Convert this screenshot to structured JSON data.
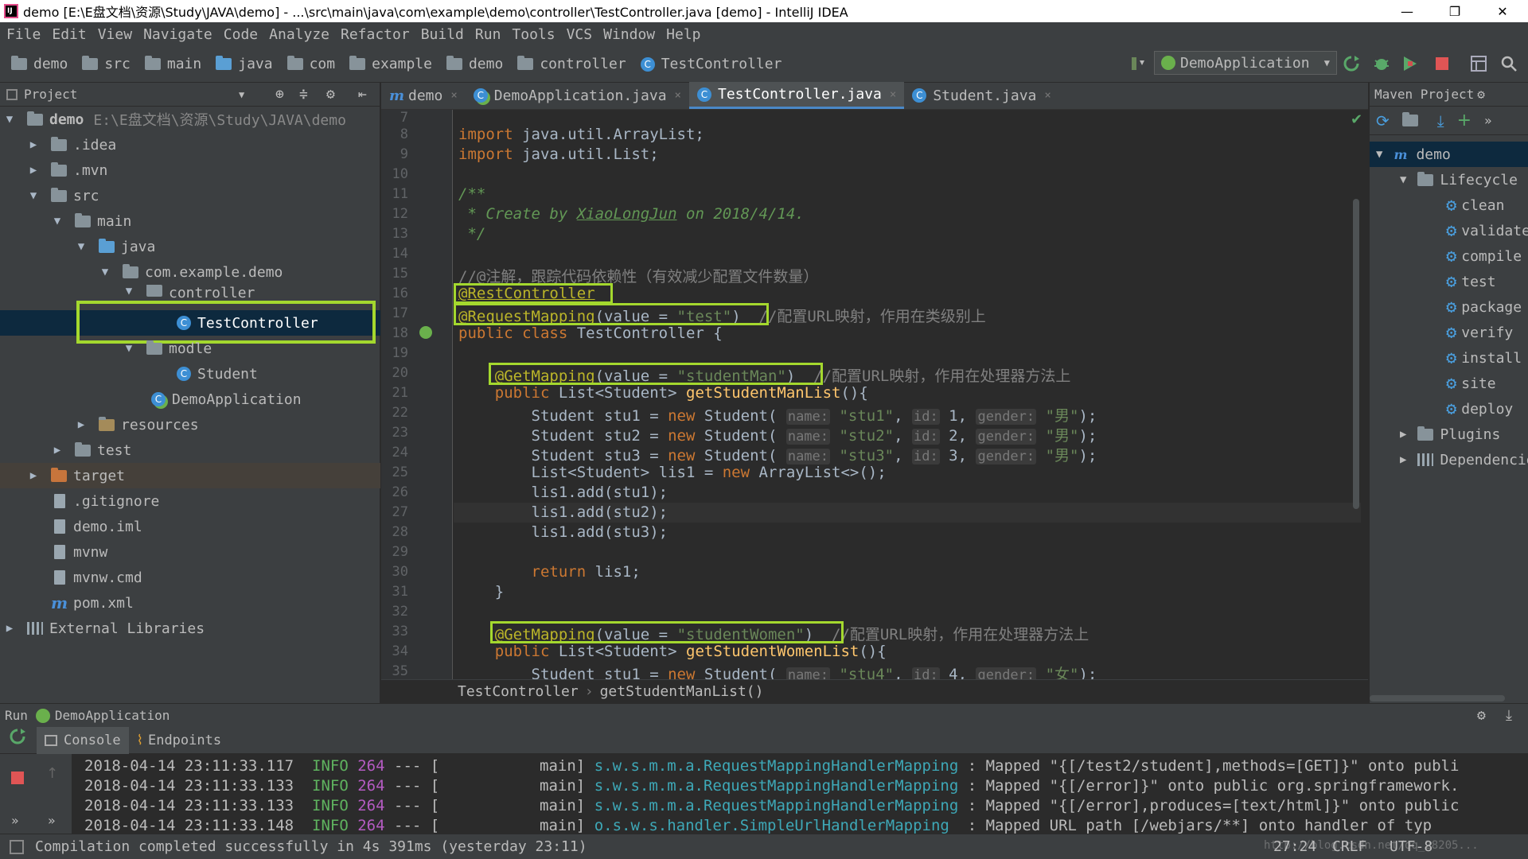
{
  "window": {
    "title": "demo [E:\\E盘文档\\资源\\Study\\JAVA\\demo] - ...\\src\\main\\java\\com\\example\\demo\\controller\\TestController.java [demo] - IntelliJ IDEA",
    "minimize": "—",
    "maximize": "❐",
    "close": "✕"
  },
  "menu": [
    "File",
    "Edit",
    "View",
    "Navigate",
    "Code",
    "Analyze",
    "Refactor",
    "Build",
    "Run",
    "Tools",
    "VCS",
    "Window",
    "Help"
  ],
  "navbar": {
    "crumbs": [
      "demo",
      "src",
      "main",
      "java",
      "com",
      "example",
      "demo",
      "controller",
      "TestController"
    ],
    "run_config": "DemoApplication"
  },
  "project": {
    "header": "Project",
    "rows": [
      {
        "label": "demo",
        "path": "E:\\E盘文档\\资源\\Study\\JAVA\\demo",
        "arrow": "▼"
      },
      {
        "label": ".idea",
        "arrow": "▶"
      },
      {
        "label": ".mvn",
        "arrow": "▶"
      },
      {
        "label": "src",
        "arrow": "▼"
      },
      {
        "label": "main",
        "arrow": "▼"
      },
      {
        "label": "java",
        "arrow": "▼"
      },
      {
        "label": "com.example.demo",
        "arrow": "▼"
      },
      {
        "label": "controller",
        "arrow": "▼"
      },
      {
        "label": "TestController",
        "arrow": ""
      },
      {
        "label": "modle",
        "arrow": "▼"
      },
      {
        "label": "Student",
        "arrow": ""
      },
      {
        "label": "DemoApplication",
        "arrow": ""
      },
      {
        "label": "resources",
        "arrow": "▶"
      },
      {
        "label": "test",
        "arrow": "▶"
      },
      {
        "label": "target",
        "arrow": "▶"
      },
      {
        "label": ".gitignore",
        "arrow": ""
      },
      {
        "label": "demo.iml",
        "arrow": ""
      },
      {
        "label": "mvnw",
        "arrow": ""
      },
      {
        "label": "mvnw.cmd",
        "arrow": ""
      },
      {
        "label": "pom.xml",
        "arrow": ""
      },
      {
        "label": "External Libraries",
        "arrow": "▶"
      }
    ]
  },
  "editor": {
    "tabs": [
      {
        "label": "demo",
        "close": "×"
      },
      {
        "label": "DemoApplication.java",
        "close": "×"
      },
      {
        "label": "TestController.java",
        "close": "×"
      },
      {
        "label": "Student.java",
        "close": "×"
      }
    ],
    "line_numbers": [
      "7",
      "8",
      "9",
      "10",
      "11",
      "12",
      "13",
      "14",
      "15",
      "16",
      "17",
      "18",
      "19",
      "20",
      "21",
      "22",
      "23",
      "24",
      "25",
      "26",
      "27",
      "28",
      "29",
      "30",
      "31",
      "32",
      "33",
      "34",
      "35"
    ],
    "footer_crumbs": [
      "TestController",
      "getStudentManList()"
    ]
  },
  "maven": {
    "header": "Maven Project",
    "root": "demo",
    "lifecycle": "Lifecycle",
    "goals": [
      "clean",
      "validate",
      "compile",
      "test",
      "package",
      "verify",
      "install",
      "site",
      "deploy"
    ],
    "plugins": "Plugins",
    "dependencies": "Dependencies"
  },
  "run": {
    "label": "Run",
    "config": "DemoApplication",
    "tabs": [
      "Console",
      "Endpoints"
    ],
    "log": [
      {
        "ts": "2018-04-14 23:11:33.117",
        "level": "INFO",
        "pid": "264",
        "sep": "--- [",
        "thread": "main]",
        "logger": "s.w.s.m.m.a.RequestMappingHandlerMapping",
        "msg": ": Mapped \"{[/test2/student],methods=[GET]}\" onto publi"
      },
      {
        "ts": "2018-04-14 23:11:33.133",
        "level": "INFO",
        "pid": "264",
        "sep": "--- [",
        "thread": "main]",
        "logger": "s.w.s.m.m.a.RequestMappingHandlerMapping",
        "msg": ": Mapped \"{[/error]}\" onto public org.springframework."
      },
      {
        "ts": "2018-04-14 23:11:33.133",
        "level": "INFO",
        "pid": "264",
        "sep": "--- [",
        "thread": "main]",
        "logger": "s.w.s.m.m.a.RequestMappingHandlerMapping",
        "msg": ": Mapped \"{[/error],produces=[text/html]}\" onto public"
      },
      {
        "ts": "2018-04-14 23:11:33.148",
        "level": "INFO",
        "pid": "264",
        "sep": "--- [",
        "thread": "main]",
        "logger": "o.s.w.s.handler.SimpleUrlHandlerMapping",
        "msg": " : Mapped URL path [/webjars/**] onto handler of typ"
      }
    ]
  },
  "status": {
    "message": "Compilation completed successfully in 4s 391ms (yesterday 23:11)",
    "position": "27:24",
    "line_sep": "CRLF",
    "encoding": "UTF-8",
    "watermark": "http://blog.csdn.net/qq_28205..."
  },
  "colors": {
    "highlight": "#a4d82e",
    "keyword": "#cc7832",
    "annotation": "#bbb529",
    "string": "#6a8759"
  }
}
